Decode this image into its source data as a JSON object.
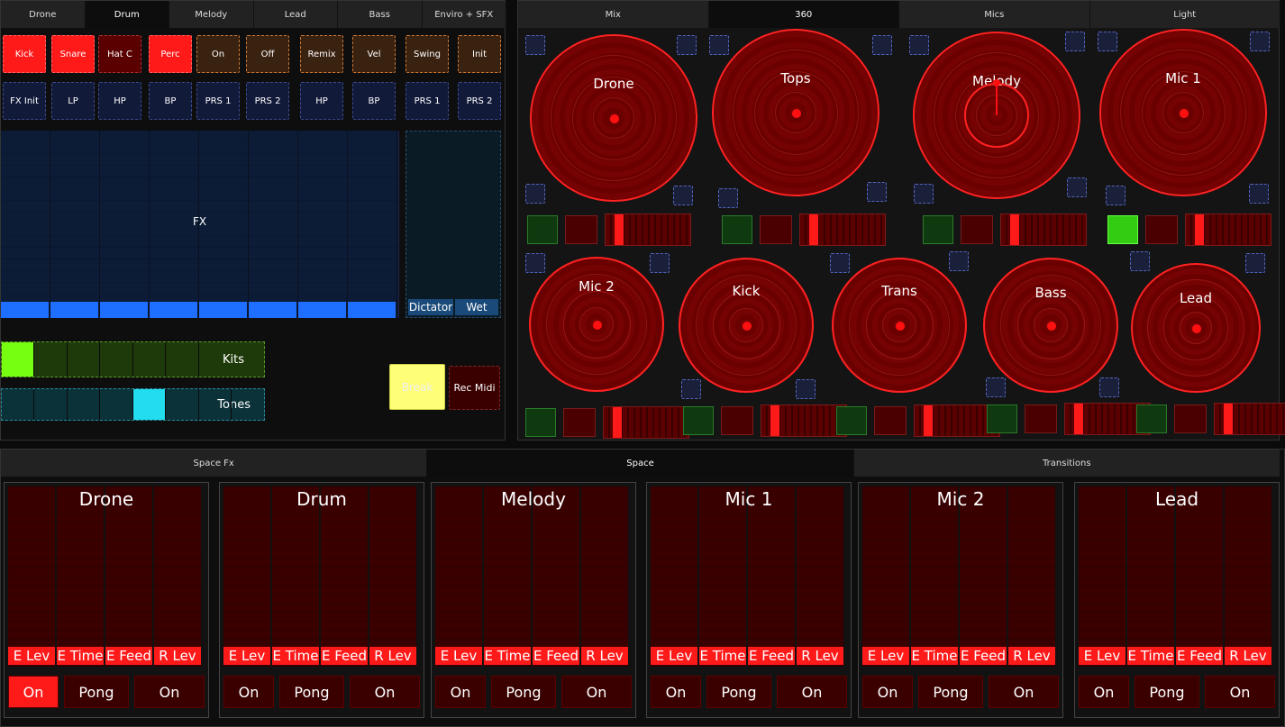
{
  "left_tabs": [
    "Drone",
    "Drum",
    "Melody",
    "Lead",
    "Bass",
    "Enviro + SFX"
  ],
  "left_active_tab": 1,
  "row1": [
    {
      "label": "Kick",
      "style": "red"
    },
    {
      "label": "Snare",
      "style": "red"
    },
    {
      "label": "Hat C",
      "style": "darkred"
    },
    {
      "label": "Perc",
      "style": "red"
    },
    {
      "label": "On",
      "style": "brown"
    },
    {
      "label": "Off",
      "style": "brown"
    },
    {
      "label": "Remix",
      "style": "brown"
    },
    {
      "label": "Vel",
      "style": "brown"
    },
    {
      "label": "Swing",
      "style": "brown"
    },
    {
      "label": "Init",
      "style": "brown"
    }
  ],
  "row2": [
    "FX Init",
    "LP",
    "HP",
    "BP",
    "PRS 1",
    "PRS 2",
    "HP",
    "BP",
    "PRS 1",
    "PRS 2"
  ],
  "fx_label": "FX",
  "dictator_label": "Dictator",
  "wet_label": "Wet",
  "kits_label": "Kits",
  "tones_label": "Tones",
  "kits_selected": 0,
  "tones_selected": 4,
  "break_label": "Break",
  "rec_midi_label": "Rec Midi",
  "right_tabs": [
    "Mix",
    "360",
    "Mics",
    "Light"
  ],
  "right_active_tab": 1,
  "circles_top": [
    "Drone",
    "Tops",
    "Melody",
    "Mic 1"
  ],
  "circles_bottom": [
    "Mic 2",
    "Kick",
    "Trans",
    "Bass",
    "Lead"
  ],
  "bottom_tabs": [
    "Space Fx",
    "Space",
    "Transitions"
  ],
  "bottom_active_tab": 1,
  "space_panels": [
    {
      "name": "Drone",
      "on_active": true
    },
    {
      "name": "Drum",
      "on_active": false
    },
    {
      "name": "Melody",
      "on_active": false
    },
    {
      "name": "Mic 1",
      "on_active": false
    },
    {
      "name": "Mic 2",
      "on_active": false
    },
    {
      "name": "Lead",
      "on_active": false
    }
  ],
  "space_tags": [
    "E Lev",
    "E Time",
    "E Feed",
    "R Lev"
  ],
  "space_buttons": [
    "On",
    "Pong",
    "On"
  ],
  "colors": {
    "accent_red": "#ff1a1a",
    "accent_green": "#33cc11",
    "accent_cyan": "#22ddee",
    "blue_fader": "#1e6fff",
    "yellow": "#ffff77"
  }
}
